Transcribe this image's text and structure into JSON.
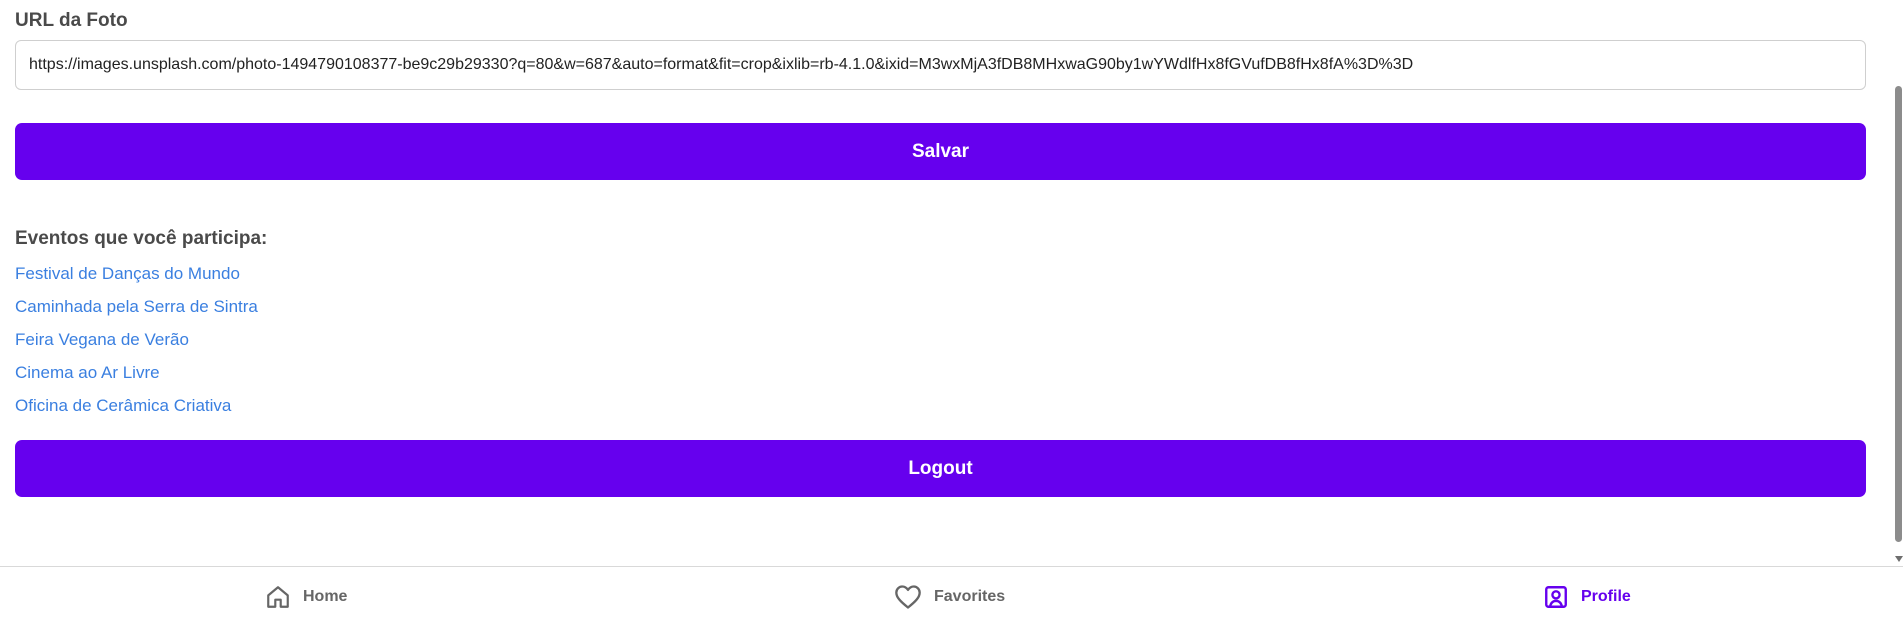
{
  "colors": {
    "accent": "#6600ee",
    "link": "#3a7fe0",
    "nav_inactive": "#666666"
  },
  "form": {
    "url_label": "URL da Foto",
    "url_value": "https://images.unsplash.com/photo-1494790108377-be9c29b29330?q=80&w=687&auto=format&fit=crop&ixlib=rb-4.1.0&ixid=M3wxMjA3fDB8MHxwaG90by1wYWdlfHx8fGVufDB8fHx8fA%3D%3D",
    "save_label": "Salvar"
  },
  "events": {
    "heading": "Eventos que você participa:",
    "items": [
      {
        "label": "Festival de Danças do Mundo"
      },
      {
        "label": "Caminhada pela Serra de Sintra"
      },
      {
        "label": "Feira Vegana de Verão"
      },
      {
        "label": "Cinema ao Ar Livre"
      },
      {
        "label": "Oficina de Cerâmica Criativa"
      }
    ]
  },
  "logout_label": "Logout",
  "bottom_nav": {
    "items": [
      {
        "label": "Home",
        "icon": "home-icon",
        "active": false
      },
      {
        "label": "Favorites",
        "icon": "heart-icon",
        "active": false
      },
      {
        "label": "Profile",
        "icon": "profile-icon",
        "active": true
      }
    ]
  }
}
